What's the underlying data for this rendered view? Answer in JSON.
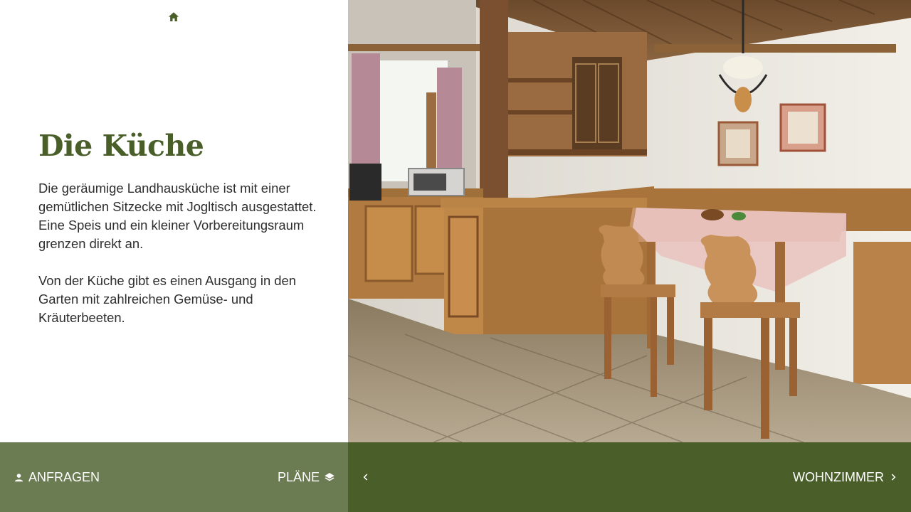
{
  "header": {
    "home_icon": "home-icon"
  },
  "content": {
    "title": "Die Küche",
    "paragraphs": [
      "Die geräumige Landhausküche ist mit einer gemütlichen Sitzecke mit Jogltisch ausgestattet. Eine Speis und ein kleiner Vorbereitungsraum grenzen direkt an.",
      "Von der Küche gibt es einen Ausgang in den Garten mit zahlreichen Gemüse- und Kräuterbeeten."
    ]
  },
  "footer": {
    "inquire_label": "ANFRAGEN",
    "inquire_icon": "person-icon",
    "plans_label": "PLÄNE",
    "plans_icon": "layers-icon",
    "prev_icon": "chevron-left-icon",
    "next_label": "WOHNZIMMER",
    "next_icon": "chevron-right-icon"
  },
  "colors": {
    "accent_green": "#4a5e2a",
    "muted_green": "#6b7c52",
    "text": "#2e2e2e",
    "background": "#ffffff"
  }
}
